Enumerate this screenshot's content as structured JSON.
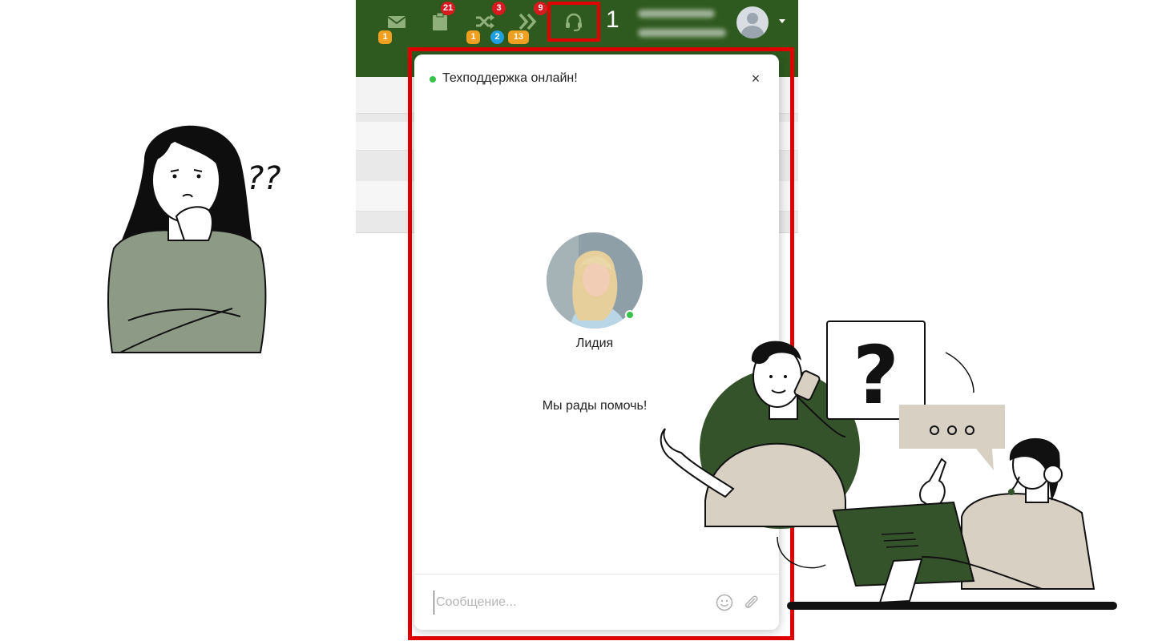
{
  "colors": {
    "topbar": "#2f5a1f",
    "highlight": "#e00000",
    "online": "#37c34a",
    "badge_red": "#d71920",
    "badge_orange": "#f0a020",
    "badge_blue": "#1e9fe0",
    "illustration_green": "#35532a",
    "illustration_beige": "#d9d0c4",
    "illustration_sage": "#8c9a86"
  },
  "topbar": {
    "icons": [
      {
        "name": "mail-icon",
        "badges": [
          {
            "value": "1",
            "color": "orange"
          }
        ]
      },
      {
        "name": "clipboard-icon",
        "badges": [
          {
            "value": "21",
            "color": "red"
          }
        ]
      },
      {
        "name": "shuffle-icon",
        "badges": [
          {
            "value": "3",
            "color": "red"
          },
          {
            "value": "1",
            "color": "orange"
          },
          {
            "value": "2",
            "color": "blue"
          },
          {
            "value": "13",
            "color": "orange"
          }
        ]
      },
      {
        "name": "double-chevron-icon",
        "badges": [
          {
            "value": "9",
            "color": "red"
          }
        ]
      },
      {
        "name": "headset-icon",
        "badges": []
      }
    ],
    "counter": "1"
  },
  "chat": {
    "title": "Техподдержка онлайн!",
    "close_label": "×",
    "operator_name": "Лидия",
    "greeting": "Мы рады помочь!",
    "input_placeholder": "Сообщение...",
    "input_value": ""
  }
}
